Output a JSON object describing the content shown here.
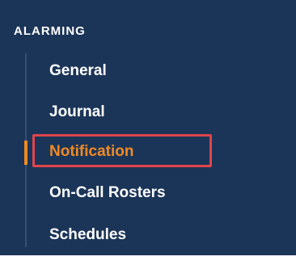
{
  "sidebar": {
    "section_title": "ALARMING",
    "items": [
      {
        "label": "General",
        "active": false
      },
      {
        "label": "Journal",
        "active": false
      },
      {
        "label": "Notification",
        "active": true
      },
      {
        "label": "On-Call Rosters",
        "active": false
      },
      {
        "label": "Schedules",
        "active": false
      }
    ]
  },
  "colors": {
    "background": "#1b3558",
    "text": "#ffffff",
    "active": "#f08a24",
    "highlight_border": "#e0454b"
  }
}
